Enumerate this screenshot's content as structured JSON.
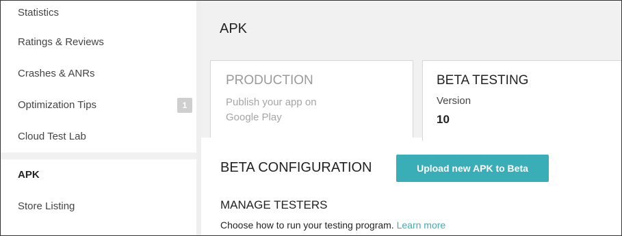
{
  "sidebar": {
    "items": [
      {
        "label": "Statistics"
      },
      {
        "label": "Ratings & Reviews"
      },
      {
        "label": "Crashes & ANRs"
      },
      {
        "label": "Optimization Tips",
        "badge": "1"
      },
      {
        "label": "Cloud Test Lab"
      }
    ],
    "items2": [
      {
        "label": "APK",
        "active": true
      },
      {
        "label": "Store Listing"
      }
    ]
  },
  "main": {
    "title": "APK",
    "tabs": {
      "production": {
        "title": "PRODUCTION",
        "description": "Publish your app on Google Play"
      },
      "beta": {
        "title": "BETA TESTING",
        "version_label": "Version",
        "version_value": "10"
      }
    },
    "beta_config": {
      "title": "BETA CONFIGURATION",
      "upload_button": "Upload new APK to Beta"
    },
    "manage_testers": {
      "title": "MANAGE TESTERS",
      "description": "Choose how to run your testing program.",
      "learn_more": "Learn more"
    }
  },
  "colors": {
    "accent": "#3aaeb6",
    "badge": "#cfcfcf",
    "panel_background": "#f1f1f1"
  }
}
